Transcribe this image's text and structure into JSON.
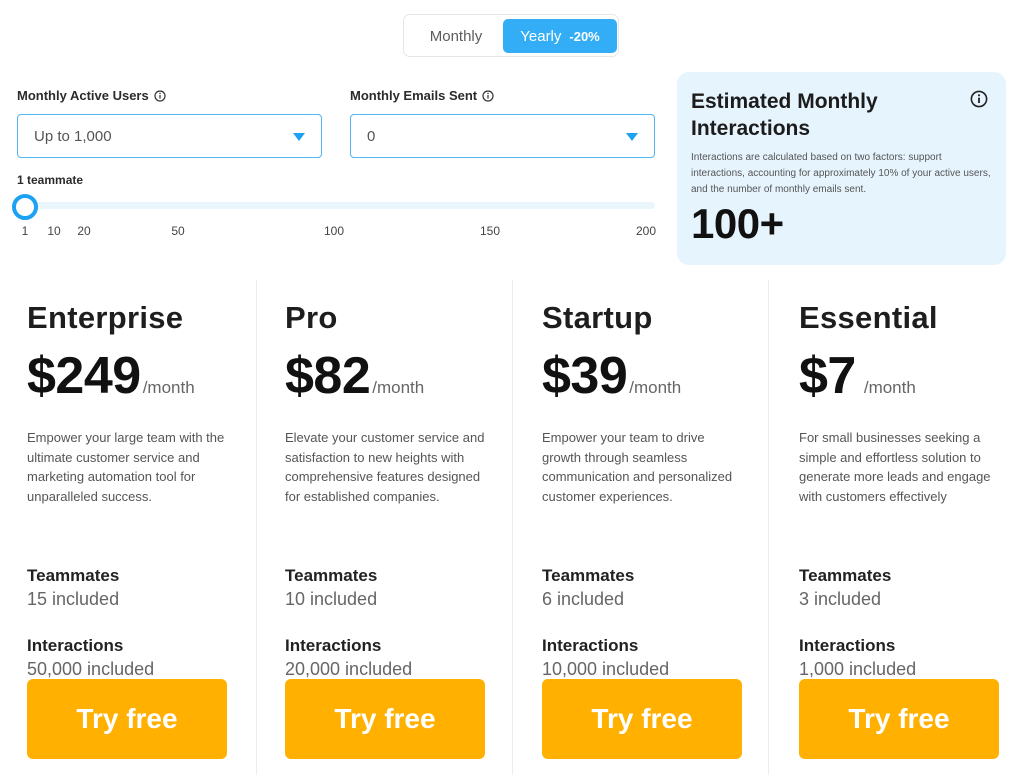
{
  "toggle": {
    "monthly": "Monthly",
    "yearly": "Yearly",
    "discount": "-20%",
    "selected": "Yearly"
  },
  "active_users": {
    "label": "Monthly Active Users",
    "value": "Up to 1,000"
  },
  "emails_sent": {
    "label": "Monthly Emails Sent",
    "value": "0"
  },
  "teammates": {
    "label": "1 teammate",
    "value": 1,
    "min": 1,
    "max": 200,
    "ticks": [
      "1",
      "10",
      "20",
      "50",
      "100",
      "150",
      "200"
    ]
  },
  "estimate": {
    "title": "Estimated Monthly Interactions",
    "description": "Interactions are calculated based on two factors: support interactions, accounting for approximately 10% of your active users, and the number of monthly emails sent.",
    "value": "100+"
  },
  "plans": [
    {
      "name": "Enterprise",
      "price": "$249",
      "period": "/month",
      "description": "Empower your large team with the ultimate customer service and marketing automation tool for unparalleled success.",
      "teammates_label": "Teammates",
      "teammates_value": "15 included",
      "interactions_label": "Interactions",
      "interactions_value": "50,000 included",
      "cta": "Try free"
    },
    {
      "name": "Pro",
      "price": "$82",
      "period": "/month",
      "description": "Elevate your customer service and satisfaction to new heights with comprehensive features designed for established companies.",
      "teammates_label": "Teammates",
      "teammates_value": "10 included",
      "interactions_label": "Interactions",
      "interactions_value": "20,000 included",
      "cta": "Try free"
    },
    {
      "name": "Startup",
      "price": "$39",
      "period": "/month",
      "description": "Empower your team to drive growth through seamless communication and personalized customer experiences.",
      "teammates_label": "Teammates",
      "teammates_value": "6 included",
      "interactions_label": "Interactions",
      "interactions_value": "10,000 included",
      "cta": "Try free"
    },
    {
      "name": "Essential",
      "price": "$7",
      "period": "/month",
      "description": "For small businesses seeking a simple and effortless solution to generate more leads and engage with customers effectively",
      "teammates_label": "Teammates",
      "teammates_value": "3 included",
      "interactions_label": "Interactions",
      "interactions_value": "1,000 included",
      "cta": "Try free"
    }
  ],
  "colors": {
    "accent": "#33aef6",
    "cta": "#ffb000",
    "estimate_bg": "#e6f4fe"
  }
}
